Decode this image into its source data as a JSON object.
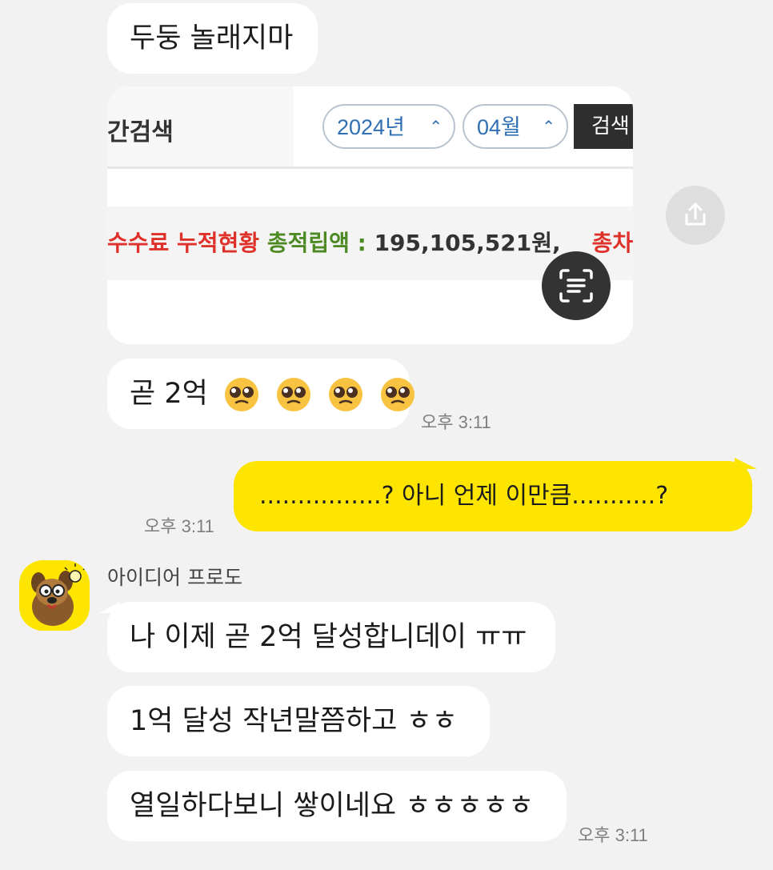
{
  "messages": {
    "m1": "두둥 놀래지마",
    "m2_text": "곧 2억",
    "m2_emojis": [
      "pleading-face",
      "pleading-face",
      "pleading-face",
      "pleading-face"
    ],
    "m2_time": "오후 3:11",
    "m3_text": "................? 아니 언제 이만큼...........?",
    "m3_time": "오후 3:11",
    "sender": "아이디어 프로도",
    "m4": "나 이제 곧 2억 달성합니데이 ㅠㅠ",
    "m5": "1억 달성 작년말쯤하고 ㅎㅎ",
    "m6": "열일하다보니 쌓이네요 ㅎㅎㅎㅎㅎ",
    "m6_time": "오후 3:11"
  },
  "image_card": {
    "section_title": "간검색",
    "year_select": "2024년",
    "month_select": "04월",
    "search_button": "검색",
    "stat_prefix": "수수료 누적현황",
    "stat_total_label": "총적립액 :",
    "stat_total_value": "195,105,521원,",
    "stat_deduct_label": "총차감액"
  },
  "icons": {
    "share": "share-icon",
    "ocr": "text-scan-icon",
    "avatar": "character-avatar"
  },
  "colors": {
    "background": "#f2f2f2",
    "my_bubble": "#fee500",
    "other_bubble": "#ffffff",
    "stat_red": "#e0302a",
    "stat_green": "#4d8a23"
  }
}
